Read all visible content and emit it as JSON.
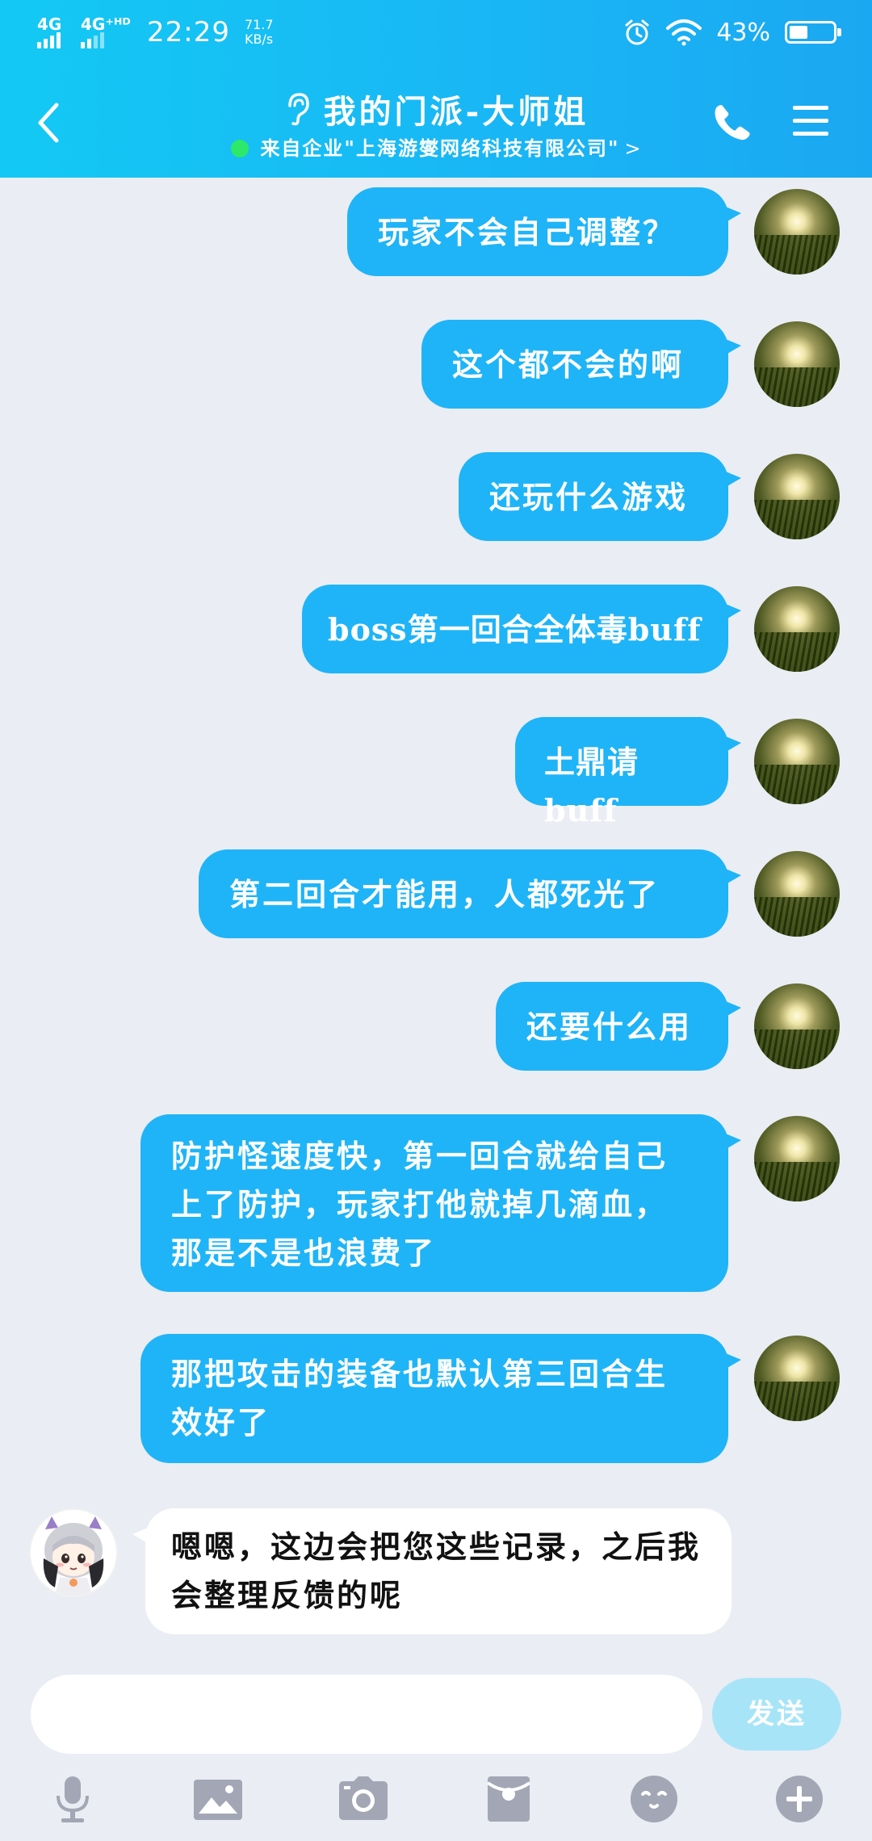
{
  "status_bar": {
    "network_1": "4G",
    "network_2": "4G⁺ᴴᴰ",
    "time": "22:29",
    "speed_value": "71.7",
    "speed_unit": "KB/s",
    "battery_text": "43%",
    "battery_level": 0.43
  },
  "header": {
    "title": "我的门派-大师姐",
    "subtitle": "来自企业\"上海游燮网络科技有限公司\"",
    "subtitle_chevron": ">",
    "online_color": "#2EE86A"
  },
  "colors": {
    "accent": "#1FB4F7",
    "header_start": "#13C9F4",
    "background": "#EAEDF4"
  },
  "messages": [
    {
      "sender": "self",
      "text": "玩家不会自己调整？"
    },
    {
      "sender": "self",
      "text": "这个都不会的啊"
    },
    {
      "sender": "self",
      "text": "还玩什么游戏"
    },
    {
      "sender": "self",
      "text": "boss第一回合全体毒buff"
    },
    {
      "sender": "self",
      "text": "土鼎请buff"
    },
    {
      "sender": "self",
      "text": "第二回合才能用，人都死光了"
    },
    {
      "sender": "self",
      "text": "还要什么用"
    },
    {
      "sender": "self",
      "text": "防护怪速度快，第一回合就给自己上了防护，玩家打他就掉几滴血，那是不是也浪费了"
    },
    {
      "sender": "self",
      "text": "那把攻击的装备也默认第三回合生效好了"
    },
    {
      "sender": "agent",
      "text": "嗯嗯，这边会把您这些记录，之后我会整理反馈的呢"
    }
  ],
  "input": {
    "value": "",
    "send_label": "发送"
  },
  "toolbar": {
    "icons": [
      "microphone-icon",
      "image-icon",
      "camera-icon",
      "red-packet-icon",
      "emoji-icon",
      "plus-icon"
    ]
  }
}
